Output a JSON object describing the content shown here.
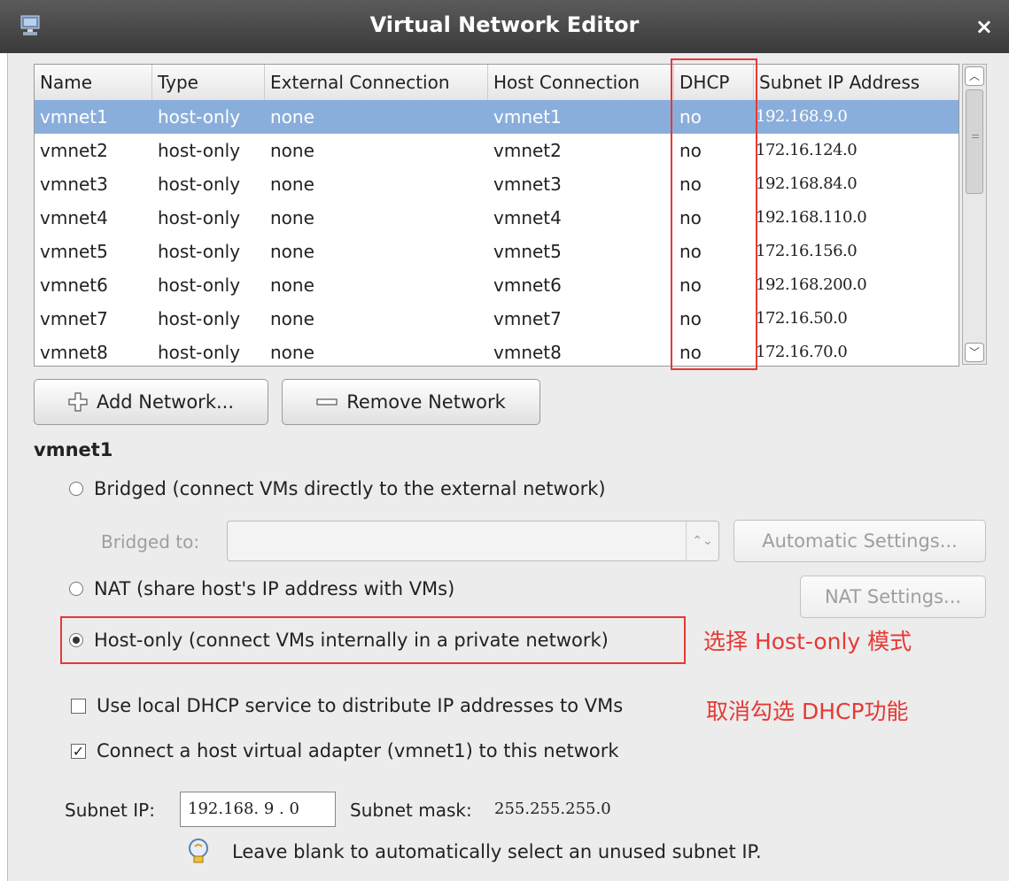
{
  "window": {
    "title": "Virtual Network Editor",
    "close_glyph": "×",
    "icon": "network-app-icon"
  },
  "table": {
    "columns": [
      "Name",
      "Type",
      "External Connection",
      "Host Connection",
      "DHCP",
      "Subnet IP Address"
    ],
    "rows": [
      {
        "name": "vmnet1",
        "type": "host-only",
        "external": "none",
        "host": "vmnet1",
        "dhcp": "no",
        "subnet": "192.168.9.0",
        "selected": true
      },
      {
        "name": "vmnet2",
        "type": "host-only",
        "external": "none",
        "host": "vmnet2",
        "dhcp": "no",
        "subnet": "172.16.124.0"
      },
      {
        "name": "vmnet3",
        "type": "host-only",
        "external": "none",
        "host": "vmnet3",
        "dhcp": "no",
        "subnet": "192.168.84.0"
      },
      {
        "name": "vmnet4",
        "type": "host-only",
        "external": "none",
        "host": "vmnet4",
        "dhcp": "no",
        "subnet": "192.168.110.0"
      },
      {
        "name": "vmnet5",
        "type": "host-only",
        "external": "none",
        "host": "vmnet5",
        "dhcp": "no",
        "subnet": "172.16.156.0"
      },
      {
        "name": "vmnet6",
        "type": "host-only",
        "external": "none",
        "host": "vmnet6",
        "dhcp": "no",
        "subnet": "192.168.200.0"
      },
      {
        "name": "vmnet7",
        "type": "host-only",
        "external": "none",
        "host": "vmnet7",
        "dhcp": "no",
        "subnet": "172.16.50.0"
      },
      {
        "name": "vmnet8",
        "type": "host-only",
        "external": "none",
        "host": "vmnet8",
        "dhcp": "no",
        "subnet": "172.16.70.0"
      }
    ]
  },
  "buttons": {
    "add_network": "Add Network...",
    "remove_network": "Remove Network"
  },
  "settings": {
    "section_title": "vmnet1",
    "bridged_label": "Bridged (connect VMs directly to the external network)",
    "bridged_to_label": "Bridged to:",
    "bridged_to_value": "",
    "automatic_settings": "Automatic Settings...",
    "nat_label": "NAT (share host's IP address with VMs)",
    "nat_settings": "NAT Settings...",
    "hostonly_label": "Host-only (connect VMs internally in a private network)",
    "selected_mode": "host-only",
    "dhcp_label": "Use local DHCP service to distribute IP addresses to VMs",
    "dhcp_checked": false,
    "adapter_label": "Connect a host virtual adapter (vmnet1) to this network",
    "adapter_checked": true,
    "subnet_ip_label": "Subnet IP:",
    "subnet_ip_value": "192.168. 9 . 0",
    "subnet_mask_label": "Subnet mask:",
    "subnet_mask_value": "255.255.255.0",
    "hint": "Leave blank to automatically select an unused subnet IP."
  },
  "annotations": {
    "hostonly_note": "选择 Host-only 模式",
    "dhcp_note": "取消勾选 DHCP功能",
    "color": "#e53935"
  },
  "colors": {
    "selection": "#8aaedb",
    "titlebar": "#3a3a3a"
  }
}
